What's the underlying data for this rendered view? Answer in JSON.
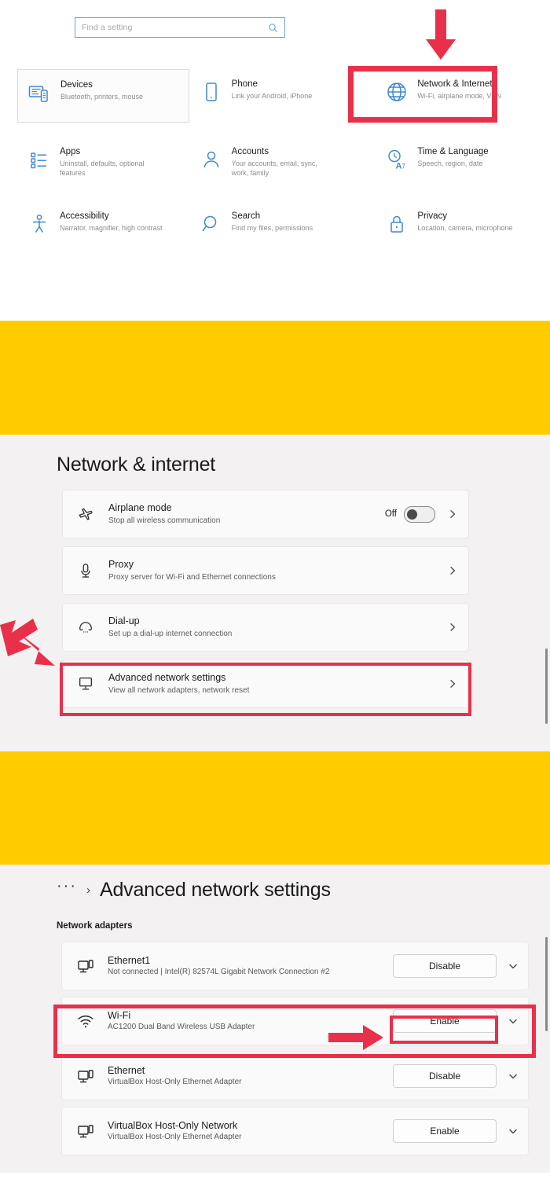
{
  "colors": {
    "accent_blue": "#3f88cf",
    "highlight_red": "#e8304a",
    "divider_yellow": "#ffcc00",
    "panel_background": "#f3f1f1",
    "card_background": "#fbfafa"
  },
  "panel_settings_home": {
    "search": {
      "placeholder": "Find a setting",
      "icon": "search-icon"
    },
    "tiles": [
      {
        "icon": "devices-icon",
        "title": "Devices",
        "subtitle": "Bluetooth, printers, mouse",
        "focused": true,
        "highlighted": false
      },
      {
        "icon": "phone-icon",
        "title": "Phone",
        "subtitle": "Link your Android, iPhone",
        "focused": false,
        "highlighted": false
      },
      {
        "icon": "globe-icon",
        "title": "Network & Internet",
        "subtitle": "Wi-Fi, airplane mode, VPN",
        "focused": false,
        "highlighted": true
      },
      {
        "icon": "apps-list-icon",
        "title": "Apps",
        "subtitle": "Uninstall, defaults, optional features",
        "focused": false,
        "highlighted": false
      },
      {
        "icon": "person-icon",
        "title": "Accounts",
        "subtitle": "Your accounts, email, sync, work, family",
        "focused": false,
        "highlighted": false
      },
      {
        "icon": "time-language-icon",
        "title": "Time & Language",
        "subtitle": "Speech, region, date",
        "focused": false,
        "highlighted": false
      },
      {
        "icon": "accessibility-icon",
        "title": "Accessibility",
        "subtitle": "Narrator, magnifier, high contrast",
        "focused": false,
        "highlighted": false
      },
      {
        "icon": "magnifier-icon",
        "title": "Search",
        "subtitle": "Find my files, permissions",
        "focused": false,
        "highlighted": false
      },
      {
        "icon": "lock-icon",
        "title": "Privacy",
        "subtitle": "Location, camera, microphone",
        "focused": false,
        "highlighted": false
      }
    ],
    "annotation": {
      "arrow": "arrow-down-icon",
      "points_to": "Network & Internet"
    }
  },
  "panel_network_internet": {
    "heading": "Network & internet",
    "cards": [
      {
        "icon": "airplane-icon",
        "title": "Airplane mode",
        "subtitle": "Stop all wireless communication",
        "toggle_label": "Off",
        "toggle_state": "off",
        "has_toggle": true,
        "chevron": "chevron-right-icon",
        "highlighted": false
      },
      {
        "icon": "proxy-icon",
        "title": "Proxy",
        "subtitle": "Proxy server for Wi-Fi and Ethernet connections",
        "has_toggle": false,
        "chevron": "chevron-right-icon",
        "highlighted": false
      },
      {
        "icon": "dialup-icon",
        "title": "Dial-up",
        "subtitle": "Set up a dial-up internet connection",
        "has_toggle": false,
        "chevron": "chevron-right-icon",
        "highlighted": false
      },
      {
        "icon": "monitor-network-icon",
        "title": "Advanced network settings",
        "subtitle": "View all network adapters, network reset",
        "has_toggle": false,
        "chevron": "chevron-right-icon",
        "highlighted": true
      }
    ],
    "annotation": {
      "arrow": "arrow-diagonal-icon",
      "points_to": "Advanced network settings"
    }
  },
  "panel_advanced_network": {
    "breadcrumb": {
      "overflow": "···",
      "separator": "›",
      "title": "Advanced network settings"
    },
    "section_label": "Network adapters",
    "adapters": [
      {
        "icon": "ethernet-icon",
        "name": "Ethernet1",
        "description": "Not connected | Intel(R) 82574L Gigabit Network Connection #2",
        "action_label": "Disable",
        "chevron": "chevron-down-icon",
        "highlighted": false
      },
      {
        "icon": "wifi-icon",
        "name": "Wi-Fi",
        "description": "AC1200  Dual Band Wireless USB Adapter",
        "action_label": "Enable",
        "chevron": "chevron-down-icon",
        "highlighted": true
      },
      {
        "icon": "ethernet-icon",
        "name": "Ethernet",
        "description": "VirtualBox Host-Only Ethernet Adapter",
        "action_label": "Disable",
        "chevron": "chevron-down-icon",
        "highlighted": false
      },
      {
        "icon": "ethernet-icon",
        "name": "VirtualBox Host-Only Network",
        "description": "VirtualBox Host-Only Ethernet Adapter",
        "action_label": "Enable",
        "chevron": "chevron-down-icon",
        "highlighted": false
      }
    ],
    "annotation": {
      "arrow": "arrow-right-icon",
      "points_to": "Enable"
    }
  }
}
